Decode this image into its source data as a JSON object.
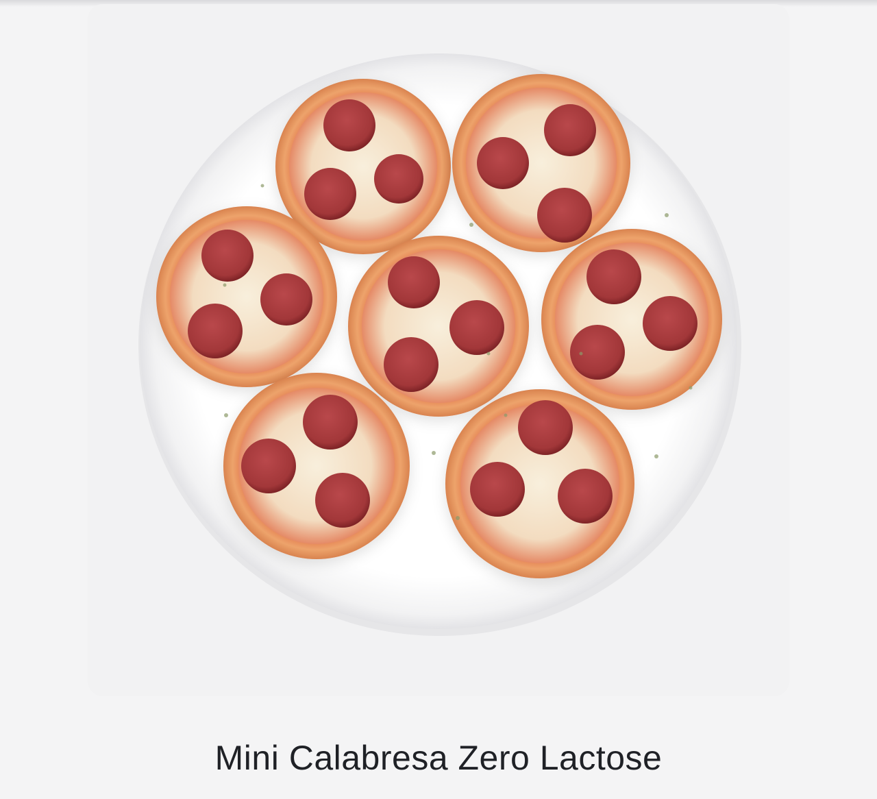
{
  "product": {
    "title": "Mini Calabresa Zero Lactose",
    "image_icon": "mini-pizza-plate-photo",
    "pizza_count": 7
  },
  "colors": {
    "page_background": "#f4f4f5",
    "card_background": "#f2f2f3",
    "plate": "#ffffff",
    "crust": "#e9a066",
    "sauce": "#d85a3e",
    "cheese": "#f6ead3",
    "pepperoni": "#a83a3c",
    "title_text": "#1f2126"
  }
}
